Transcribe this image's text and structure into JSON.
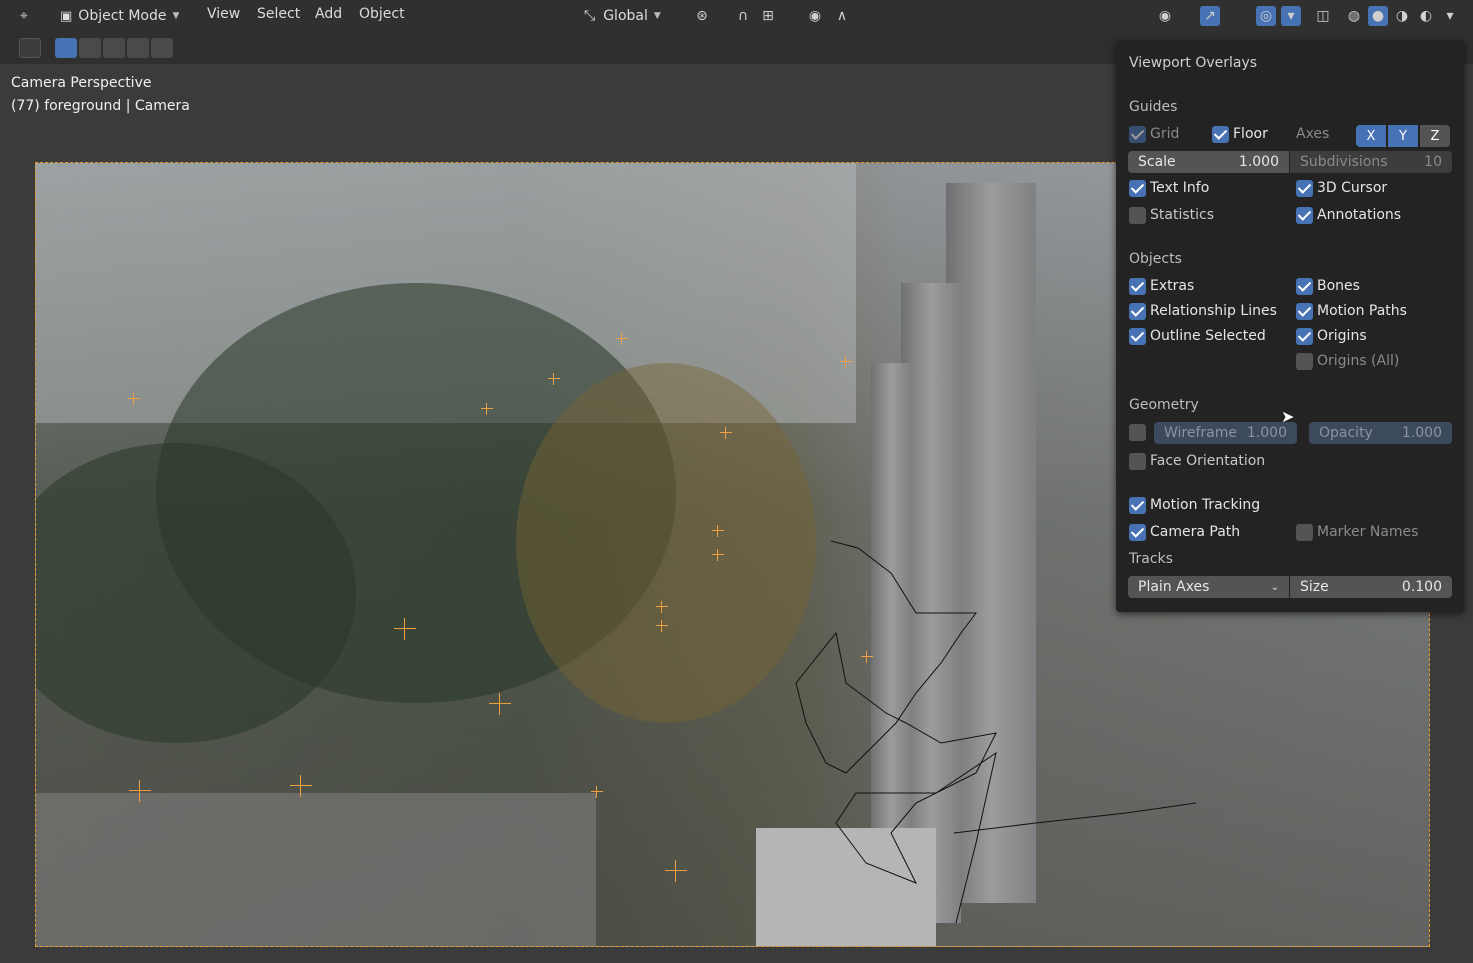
{
  "header": {
    "mode": "Object Mode",
    "menus": [
      "View",
      "Select",
      "Add",
      "Object"
    ],
    "orientation": "Global"
  },
  "viewport": {
    "line1": "Camera Perspective",
    "line2": "(77) foreground | Camera"
  },
  "overlays": {
    "title": "Viewport Overlays",
    "guides": {
      "title": "Guides",
      "grid": "Grid",
      "floor": "Floor",
      "axes": "Axes",
      "x": "X",
      "y": "Y",
      "z": "Z",
      "scale_label": "Scale",
      "scale_value": "1.000",
      "subdiv_label": "Subdivisions",
      "subdiv_value": "10",
      "text_info": "Text Info",
      "cursor": "3D Cursor",
      "statistics": "Statistics",
      "annotations": "Annotations"
    },
    "objects": {
      "title": "Objects",
      "extras": "Extras",
      "bones": "Bones",
      "relationship": "Relationship Lines",
      "motion_paths": "Motion Paths",
      "outline": "Outline Selected",
      "origins": "Origins",
      "origins_all": "Origins (All)"
    },
    "geometry": {
      "title": "Geometry",
      "wireframe_label": "Wireframe",
      "wireframe_value": "1.000",
      "opacity_label": "Opacity",
      "opacity_value": "1.000",
      "face_orientation": "Face Orientation"
    },
    "tracking": {
      "motion_tracking": "Motion Tracking",
      "camera_path": "Camera Path",
      "marker_names": "Marker Names",
      "tracks_title": "Tracks",
      "tracks_value": "Plain Axes",
      "size_label": "Size",
      "size_value": "0.100"
    }
  }
}
